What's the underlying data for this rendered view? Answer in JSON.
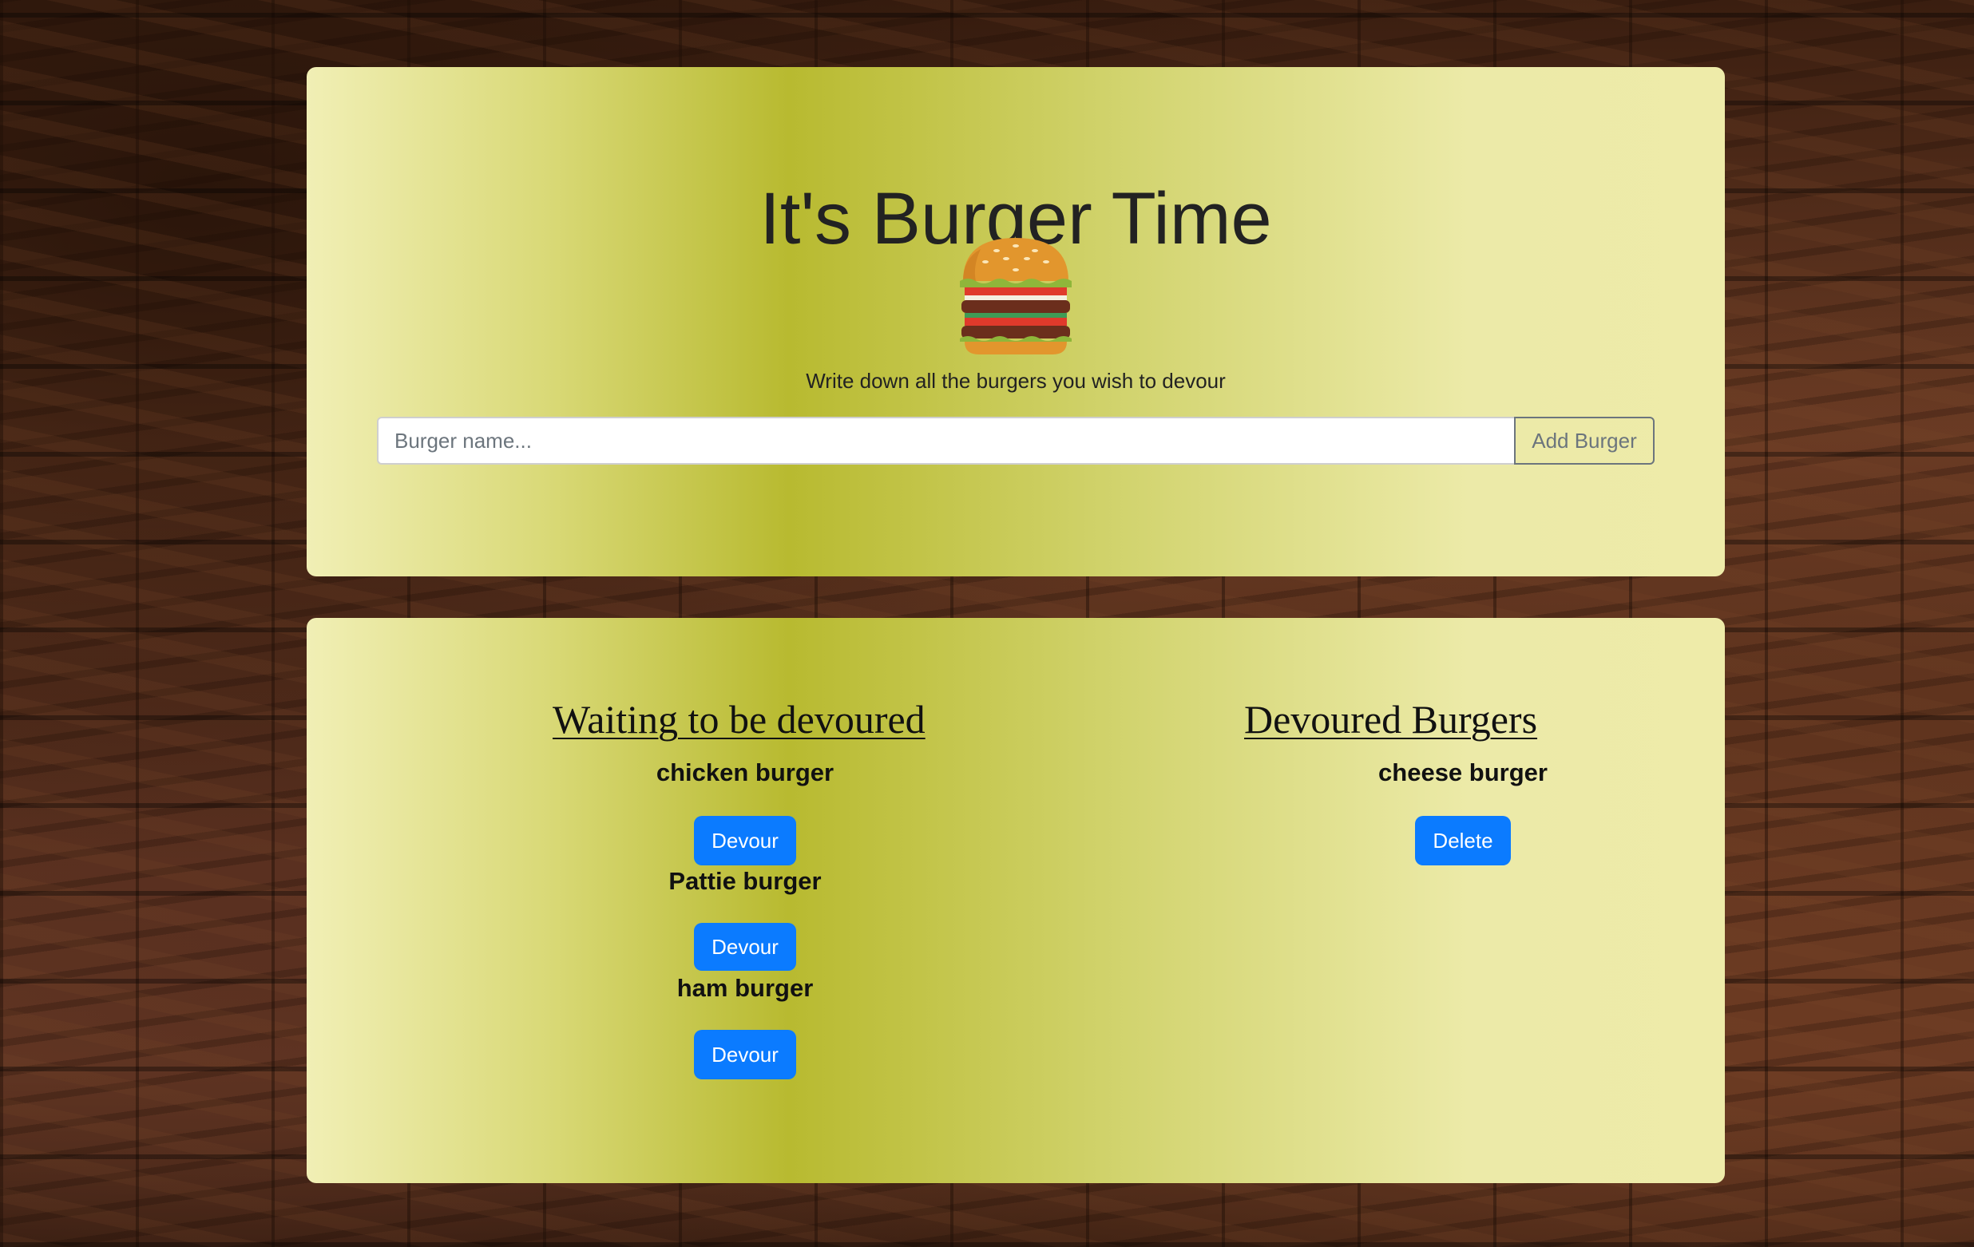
{
  "header": {
    "title": "It's Burger Time",
    "icon": "hamburger-icon",
    "subtitle": "Write down all the burgers you wish to devour",
    "input_placeholder": "Burger name...",
    "add_button_label": "Add Burger"
  },
  "waiting": {
    "heading": "Waiting to be devoured",
    "items": [
      {
        "name": "chicken burger",
        "button": "Devour"
      },
      {
        "name": "Pattie burger",
        "button": "Devour"
      },
      {
        "name": "ham burger",
        "button": "Devour"
      }
    ]
  },
  "devoured": {
    "heading": "Devoured Burgers",
    "items": [
      {
        "name": "cheese burger",
        "button": "Delete"
      }
    ]
  },
  "colors": {
    "button_blue": "#0b7bff",
    "panel_olive": "#b8ba30",
    "panel_light": "#f1efb5"
  }
}
